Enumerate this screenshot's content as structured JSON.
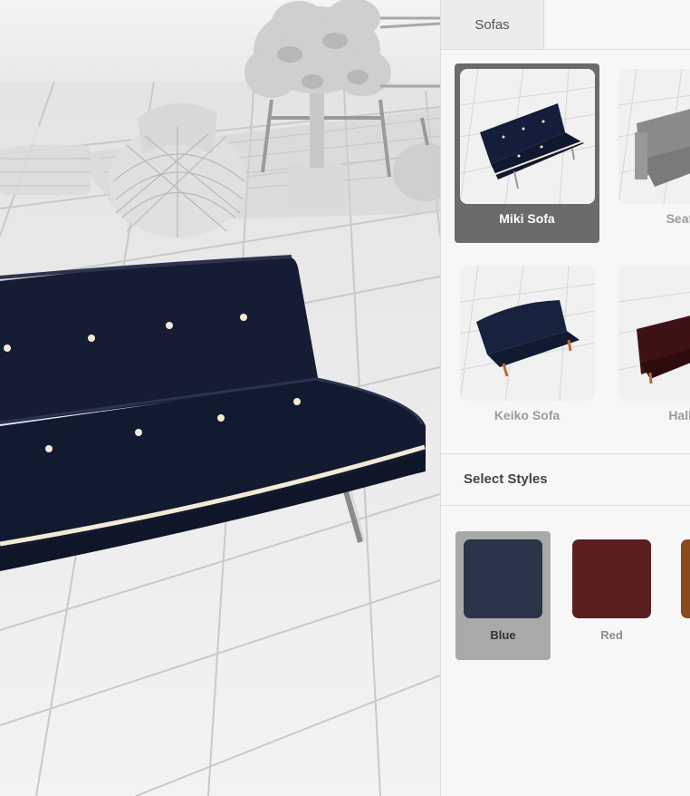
{
  "tabs": [
    {
      "label": "Sofas"
    }
  ],
  "products": [
    {
      "name": "Miki Sofa",
      "selected": true,
      "color": "#141e3a"
    },
    {
      "name": "Seater",
      "selected": false,
      "color": "#8a8a8a"
    },
    {
      "name": "Keiko Sofa",
      "selected": false,
      "color": "#17223e"
    },
    {
      "name": "Hallie",
      "selected": false,
      "color": "#3e1214"
    }
  ],
  "styles_section": {
    "title": "Select Styles",
    "items": [
      {
        "name": "Blue",
        "color": "#2b3448",
        "selected": true
      },
      {
        "name": "Red",
        "color": "#5c1f1f",
        "selected": false
      },
      {
        "name": "",
        "color": "#8a4a1e",
        "selected": false
      }
    ]
  },
  "colors": {
    "sofa_fabric": "#151c33",
    "piping": "#f3ead6",
    "selected_card": "#6b6b6b",
    "selected_style": "#a9a9a9"
  }
}
